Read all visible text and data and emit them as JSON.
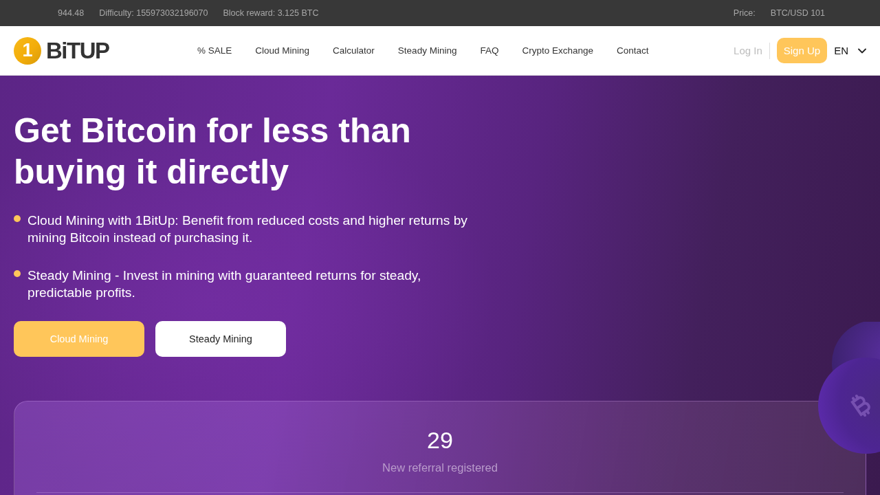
{
  "ticker": {
    "items": [
      "944.48",
      "Difficulty: 155973032196070",
      "Block reward: 3.125 BTC"
    ],
    "price_label": "Price:",
    "price_value": "BTC/USD 101"
  },
  "header": {
    "logo": {
      "mark": "1",
      "wordmark": "BiTUP"
    },
    "nav": [
      "% SALE",
      "Cloud Mining",
      "Calculator",
      "Steady Mining",
      "FAQ",
      "Crypto Exchange",
      "Contact"
    ],
    "login": "Log In",
    "signup": "Sign Up",
    "language": "EN"
  },
  "hero": {
    "title": "Get Bitcoin for less than buying it directly",
    "bullets": [
      "Cloud Mining with 1BitUp: Benefit from reduced costs and higher returns by mining Bitcoin instead of purchasing it.",
      "Steady Mining - Invest in mining with guaranteed returns for steady, predictable profits."
    ],
    "buttons": [
      {
        "label": "Cloud Mining",
        "kind": "primary"
      },
      {
        "label": "Steady Mining",
        "kind": "secondary"
      }
    ]
  },
  "stats": {
    "value": "29",
    "label": "New referral registered"
  }
}
